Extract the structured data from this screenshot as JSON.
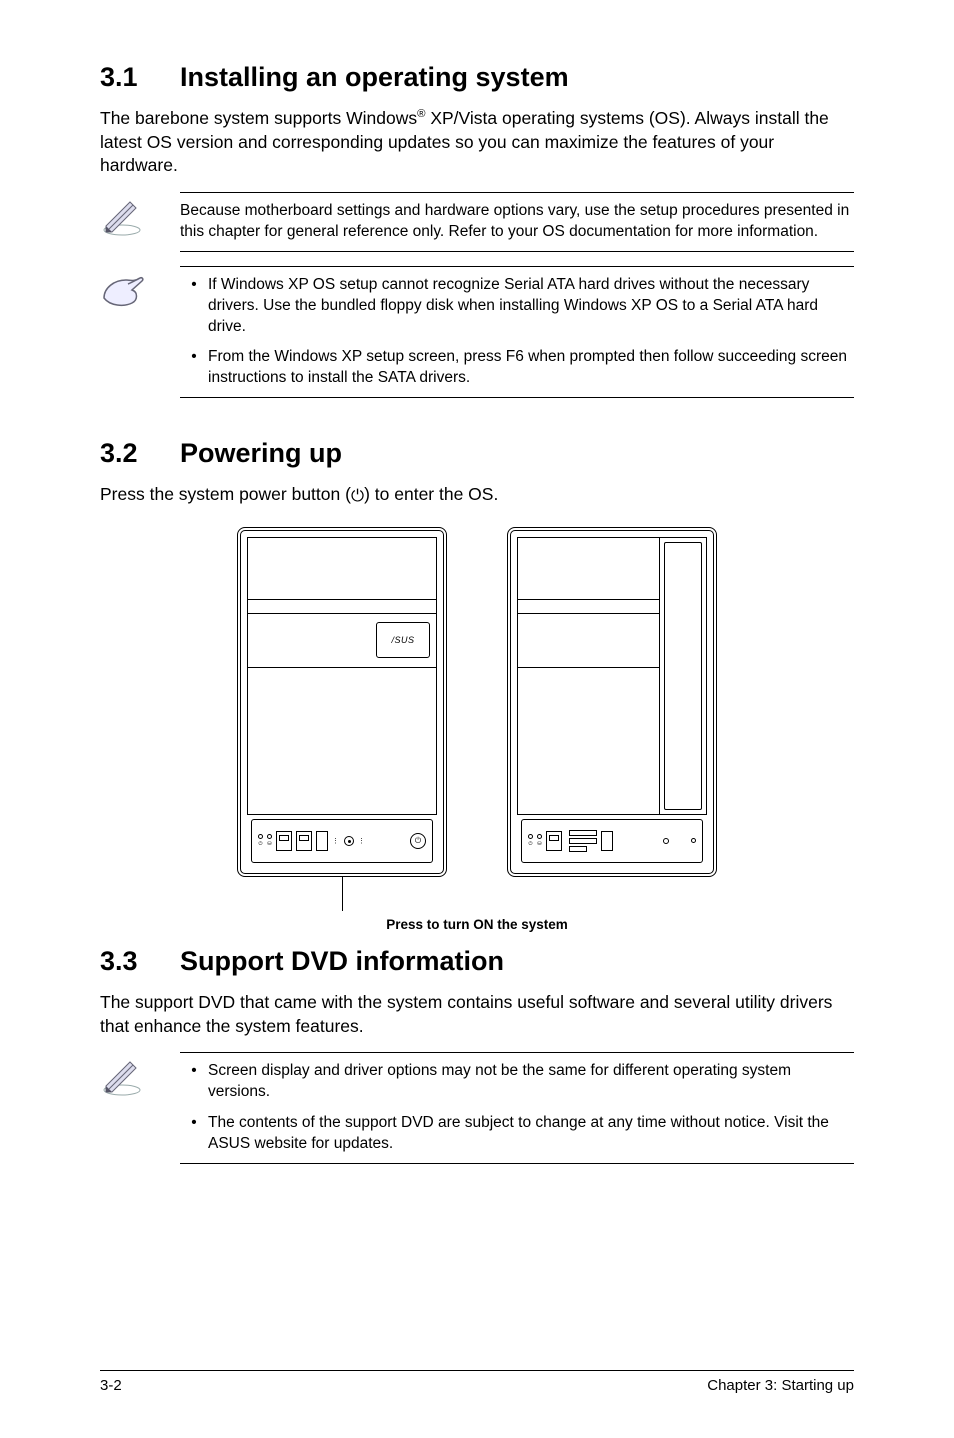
{
  "sections": {
    "s1": {
      "num": "3.1",
      "title": "Installing an operating system"
    },
    "s2": {
      "num": "3.2",
      "title": "Powering up"
    },
    "s3": {
      "num": "3.3",
      "title": "Support DVD information"
    }
  },
  "body": {
    "p1a": "The barebone system supports Windows",
    "p1b": " XP/Vista operating systems (OS). Always install the latest OS version and corresponding updates so you can maximize the features of your hardware.",
    "sup_reg": "®",
    "p2a": "Press the system power button (",
    "p2b": ") to enter the OS.",
    "power_sym": "⏻",
    "p3": "The support DVD that came with the system contains useful software and several utility drivers that enhance the system features."
  },
  "notes": {
    "n1": "Because motherboard settings and hardware options vary, use the setup procedures presented in this chapter for general reference only. Refer to your OS documentation for more information.",
    "n2a": "If Windows XP OS setup cannot recognize Serial ATA hard drives without the necessary drivers. Use the bundled floppy disk when installing Windows XP OS to a Serial ATA hard drive.",
    "n2b": "From the Windows XP setup screen, press F6 when prompted then follow succeeding screen instructions to install the SATA drivers.",
    "n3a": "Screen display and driver options may not be the same for different operating system versions.",
    "n3b": "The contents of the support DVD are subject to change at any time without notice. Visit the ASUS website for updates."
  },
  "figure": {
    "logo": "/SUS",
    "caption": "Press to turn ON the system"
  },
  "footer": {
    "left": "3-2",
    "right": "Chapter 3: Starting up"
  },
  "glyphs": {
    "bullet": "•"
  }
}
